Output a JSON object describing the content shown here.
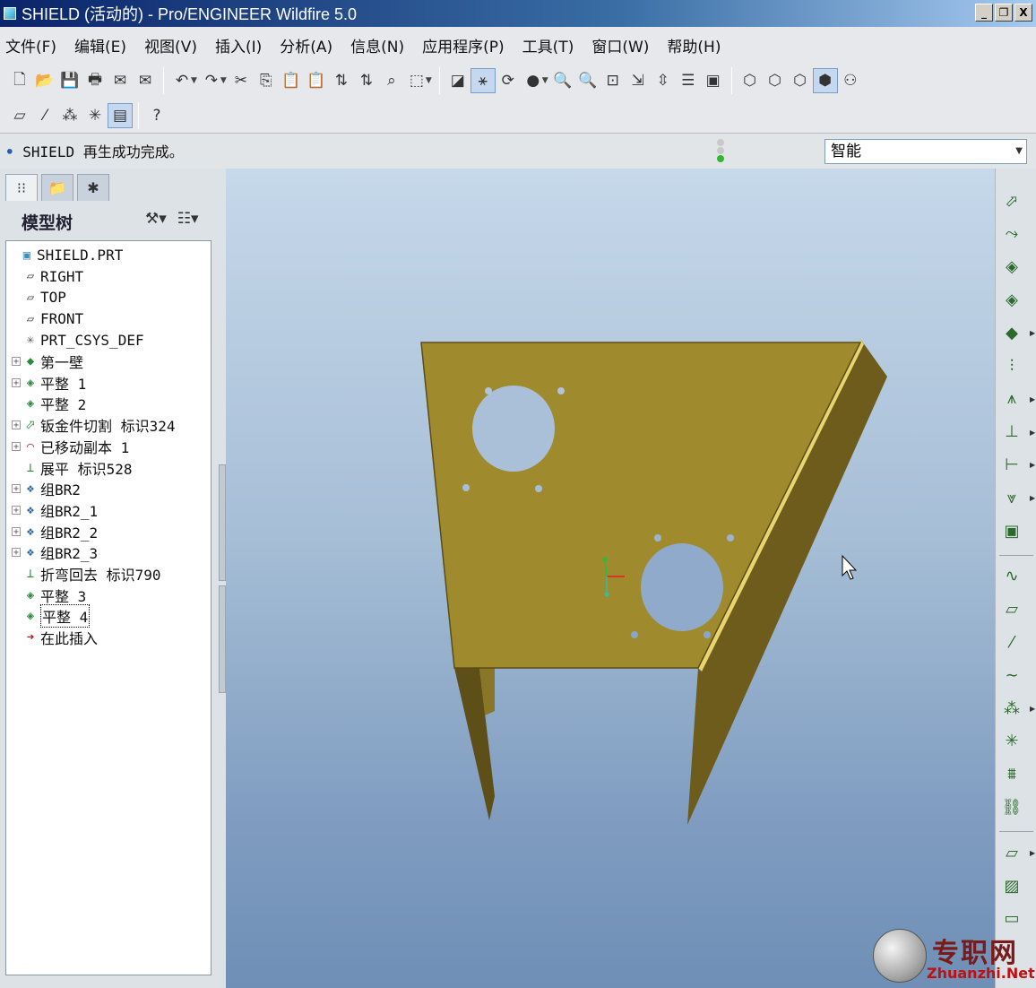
{
  "window": {
    "title": "SHIELD (活动的) - Pro/ENGINEER Wildfire 5.0",
    "controls": [
      "_",
      "❐",
      "X"
    ]
  },
  "menu": [
    "文件(F)",
    "编辑(E)",
    "视图(V)",
    "插入(I)",
    "分析(A)",
    "信息(N)",
    "应用程序(P)",
    "工具(T)",
    "窗口(W)",
    "帮助(H)"
  ],
  "status": {
    "message": "SHIELD 再生成功完成。",
    "filter_value": "智能"
  },
  "panel": {
    "tree_title": "模型树"
  },
  "model_tree": [
    {
      "label": "SHIELD.PRT",
      "icon": "part-icon",
      "expand": false,
      "indent": 0
    },
    {
      "label": "RIGHT",
      "icon": "datum-plane-icon",
      "expand": false,
      "indent": 1
    },
    {
      "label": "TOP",
      "icon": "datum-plane-icon",
      "expand": false,
      "indent": 1
    },
    {
      "label": "FRONT",
      "icon": "datum-plane-icon",
      "expand": false,
      "indent": 1
    },
    {
      "label": "PRT_CSYS_DEF",
      "icon": "csys-icon",
      "expand": false,
      "indent": 1
    },
    {
      "label": "第一壁",
      "icon": "first-wall-icon",
      "expand": true,
      "indent": 1
    },
    {
      "label": "平整 1",
      "icon": "flat-wall-icon",
      "expand": true,
      "indent": 1
    },
    {
      "label": "平整 2",
      "icon": "flat-wall-icon",
      "expand": false,
      "indent": 1
    },
    {
      "label": "钣金件切割 标识324",
      "icon": "sheetmetal-cut-icon",
      "expand": true,
      "indent": 1
    },
    {
      "label": "已移动副本 1",
      "icon": "moved-copy-icon",
      "expand": true,
      "indent": 1
    },
    {
      "label": "展平 标识528",
      "icon": "unbend-icon",
      "expand": false,
      "indent": 1
    },
    {
      "label": "组BR2",
      "icon": "group-icon",
      "expand": true,
      "indent": 1
    },
    {
      "label": "组BR2_1",
      "icon": "group-icon",
      "expand": true,
      "indent": 1
    },
    {
      "label": "组BR2_2",
      "icon": "group-icon",
      "expand": true,
      "indent": 1
    },
    {
      "label": "组BR2_3",
      "icon": "group-icon",
      "expand": true,
      "indent": 1
    },
    {
      "label": "折弯回去 标识790",
      "icon": "bend-back-icon",
      "expand": false,
      "indent": 1
    },
    {
      "label": "平整 3",
      "icon": "flat-wall-icon",
      "expand": false,
      "indent": 1
    },
    {
      "label": "平整 4",
      "icon": "flat-wall-icon",
      "expand": false,
      "indent": 1,
      "selected": true
    },
    {
      "label": "在此插入",
      "icon": "insert-here-icon",
      "expand": false,
      "indent": 1
    }
  ],
  "watermark": {
    "cn": "专职网",
    "en": "Zhuanzhi.Net"
  },
  "colors": {
    "part_face": "#a08a2e",
    "part_dark": "#6e5c1c",
    "part_edge": "#e8d470",
    "viewport_top": "#c6d8ea",
    "viewport_bottom": "#6f8fb6"
  }
}
